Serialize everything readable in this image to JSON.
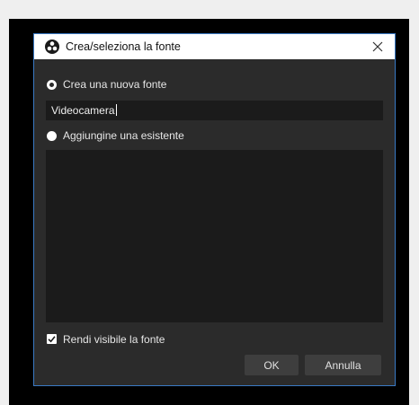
{
  "dialog": {
    "title": "Crea/seleziona la fonte",
    "close_icon": "close-icon",
    "app_icon": "obs-logo-icon"
  },
  "options": {
    "create_new_label": "Crea una nuova fonte",
    "create_new_selected": true,
    "add_existing_label": "Aggiungine una esistente",
    "add_existing_selected": false
  },
  "name_input": {
    "value": "Videocamera"
  },
  "existing_sources": [],
  "visible_checkbox": {
    "label": "Rendi visibile la fonte",
    "checked": true
  },
  "buttons": {
    "ok_label": "OK",
    "cancel_label": "Annulla"
  },
  "colors": {
    "dialog_bg": "#2b2b2b",
    "field_bg": "#1b1b1b",
    "border_accent": "#3a79c4"
  }
}
